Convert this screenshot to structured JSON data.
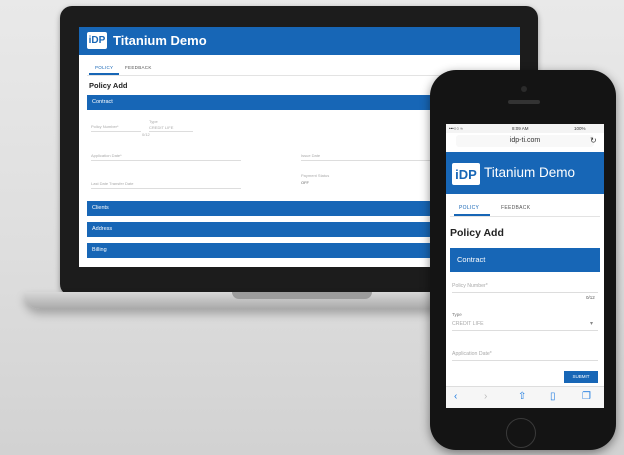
{
  "app": {
    "title": "Titanium Demo",
    "logo": "iDP"
  },
  "tabs": {
    "policy": "POLICY",
    "feedback": "FEEDBACK"
  },
  "page_title": "Policy Add",
  "sections": {
    "contract": "Contract",
    "clients": "Clients",
    "address": "Address",
    "billing": "Billing"
  },
  "laptop_fields": {
    "policy_number": "Policy Number*",
    "type": "Type",
    "type_value": "CREDIT LIFE",
    "application_date": "Application Date*",
    "issue_date": "Issue Date",
    "last_date_transfer": "Last Date Transfer Date",
    "payment_status": "Payment Status",
    "payment_value": "OFF",
    "count": "0/12"
  },
  "phone": {
    "status_left": "•••○○ ≈",
    "status_time": "8:09 AM",
    "status_right": "100%",
    "url": "idp-ti.com",
    "reload_icon": "reload-icon",
    "policy_number": "Policy Number*",
    "counter": "0/12",
    "type": "Type",
    "type_value": "CREDIT LIFE",
    "application_date": "Application Date*",
    "submit": "SUBMIT"
  },
  "colors": {
    "brand": "#1766b6"
  },
  "icons": [
    "back-icon",
    "forward-icon",
    "share-icon",
    "bookmarks-icon",
    "tabs-icon",
    "chevron-down-icon"
  ]
}
